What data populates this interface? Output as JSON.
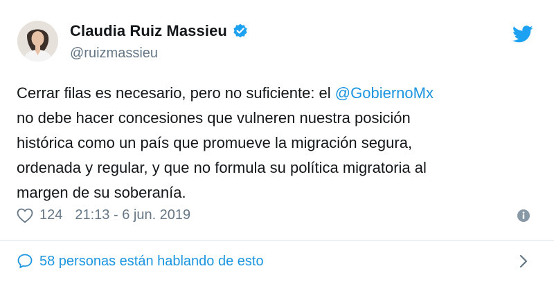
{
  "author": {
    "name": "Claudia Ruiz Massieu",
    "handle": "@ruizmassieu"
  },
  "tweet": {
    "lines": [
      {
        "before": "Cerrar filas es necesario, pero no suficiente: el ",
        "mention": "@GobiernoMx"
      },
      {
        "text": "no debe hacer concesiones que vulneren nuestra posición"
      },
      {
        "text": "histórica como un país que promueve la migración segura,"
      },
      {
        "text": "ordenada y regular, y que no formula su política migratoria al"
      },
      {
        "text": "margen de su soberanía."
      }
    ],
    "likes": "124",
    "timestamp": "21:13 - 6 jun. 2019"
  },
  "footer": {
    "conversation_label": "58 personas están hablando de esto"
  },
  "icons": {
    "verified": "verified-badge-icon",
    "platform": "twitter-bird-icon",
    "like": "heart-icon",
    "info": "info-icon",
    "conversation": "speech-bubble-icon",
    "chevron": "chevron-right-icon"
  },
  "colors": {
    "accent": "#1b95e0",
    "secondary_text": "#657786",
    "primary_text": "#14171a"
  }
}
